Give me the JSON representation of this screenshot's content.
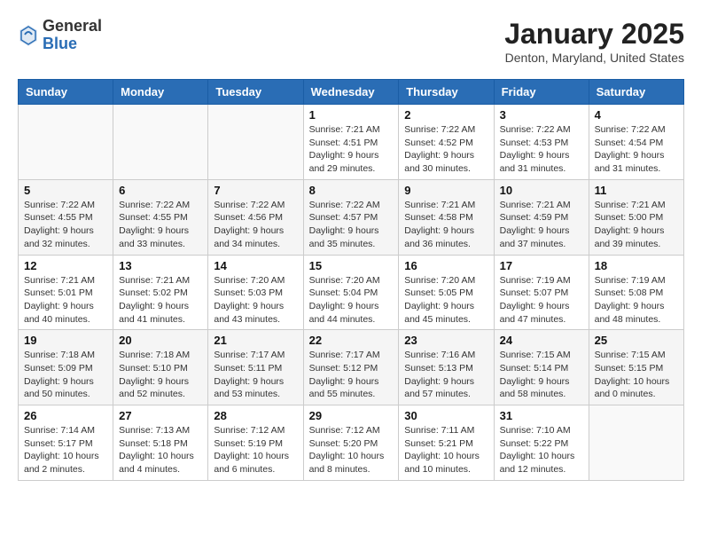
{
  "header": {
    "logo_general": "General",
    "logo_blue": "Blue",
    "month": "January 2025",
    "location": "Denton, Maryland, United States"
  },
  "weekdays": [
    "Sunday",
    "Monday",
    "Tuesday",
    "Wednesday",
    "Thursday",
    "Friday",
    "Saturday"
  ],
  "weeks": [
    [
      {
        "day": "",
        "sunrise": "",
        "sunset": "",
        "daylight": ""
      },
      {
        "day": "",
        "sunrise": "",
        "sunset": "",
        "daylight": ""
      },
      {
        "day": "",
        "sunrise": "",
        "sunset": "",
        "daylight": ""
      },
      {
        "day": "1",
        "sunrise": "Sunrise: 7:21 AM",
        "sunset": "Sunset: 4:51 PM",
        "daylight": "Daylight: 9 hours and 29 minutes."
      },
      {
        "day": "2",
        "sunrise": "Sunrise: 7:22 AM",
        "sunset": "Sunset: 4:52 PM",
        "daylight": "Daylight: 9 hours and 30 minutes."
      },
      {
        "day": "3",
        "sunrise": "Sunrise: 7:22 AM",
        "sunset": "Sunset: 4:53 PM",
        "daylight": "Daylight: 9 hours and 31 minutes."
      },
      {
        "day": "4",
        "sunrise": "Sunrise: 7:22 AM",
        "sunset": "Sunset: 4:54 PM",
        "daylight": "Daylight: 9 hours and 31 minutes."
      }
    ],
    [
      {
        "day": "5",
        "sunrise": "Sunrise: 7:22 AM",
        "sunset": "Sunset: 4:55 PM",
        "daylight": "Daylight: 9 hours and 32 minutes."
      },
      {
        "day": "6",
        "sunrise": "Sunrise: 7:22 AM",
        "sunset": "Sunset: 4:55 PM",
        "daylight": "Daylight: 9 hours and 33 minutes."
      },
      {
        "day": "7",
        "sunrise": "Sunrise: 7:22 AM",
        "sunset": "Sunset: 4:56 PM",
        "daylight": "Daylight: 9 hours and 34 minutes."
      },
      {
        "day": "8",
        "sunrise": "Sunrise: 7:22 AM",
        "sunset": "Sunset: 4:57 PM",
        "daylight": "Daylight: 9 hours and 35 minutes."
      },
      {
        "day": "9",
        "sunrise": "Sunrise: 7:21 AM",
        "sunset": "Sunset: 4:58 PM",
        "daylight": "Daylight: 9 hours and 36 minutes."
      },
      {
        "day": "10",
        "sunrise": "Sunrise: 7:21 AM",
        "sunset": "Sunset: 4:59 PM",
        "daylight": "Daylight: 9 hours and 37 minutes."
      },
      {
        "day": "11",
        "sunrise": "Sunrise: 7:21 AM",
        "sunset": "Sunset: 5:00 PM",
        "daylight": "Daylight: 9 hours and 39 minutes."
      }
    ],
    [
      {
        "day": "12",
        "sunrise": "Sunrise: 7:21 AM",
        "sunset": "Sunset: 5:01 PM",
        "daylight": "Daylight: 9 hours and 40 minutes."
      },
      {
        "day": "13",
        "sunrise": "Sunrise: 7:21 AM",
        "sunset": "Sunset: 5:02 PM",
        "daylight": "Daylight: 9 hours and 41 minutes."
      },
      {
        "day": "14",
        "sunrise": "Sunrise: 7:20 AM",
        "sunset": "Sunset: 5:03 PM",
        "daylight": "Daylight: 9 hours and 43 minutes."
      },
      {
        "day": "15",
        "sunrise": "Sunrise: 7:20 AM",
        "sunset": "Sunset: 5:04 PM",
        "daylight": "Daylight: 9 hours and 44 minutes."
      },
      {
        "day": "16",
        "sunrise": "Sunrise: 7:20 AM",
        "sunset": "Sunset: 5:05 PM",
        "daylight": "Daylight: 9 hours and 45 minutes."
      },
      {
        "day": "17",
        "sunrise": "Sunrise: 7:19 AM",
        "sunset": "Sunset: 5:07 PM",
        "daylight": "Daylight: 9 hours and 47 minutes."
      },
      {
        "day": "18",
        "sunrise": "Sunrise: 7:19 AM",
        "sunset": "Sunset: 5:08 PM",
        "daylight": "Daylight: 9 hours and 48 minutes."
      }
    ],
    [
      {
        "day": "19",
        "sunrise": "Sunrise: 7:18 AM",
        "sunset": "Sunset: 5:09 PM",
        "daylight": "Daylight: 9 hours and 50 minutes."
      },
      {
        "day": "20",
        "sunrise": "Sunrise: 7:18 AM",
        "sunset": "Sunset: 5:10 PM",
        "daylight": "Daylight: 9 hours and 52 minutes."
      },
      {
        "day": "21",
        "sunrise": "Sunrise: 7:17 AM",
        "sunset": "Sunset: 5:11 PM",
        "daylight": "Daylight: 9 hours and 53 minutes."
      },
      {
        "day": "22",
        "sunrise": "Sunrise: 7:17 AM",
        "sunset": "Sunset: 5:12 PM",
        "daylight": "Daylight: 9 hours and 55 minutes."
      },
      {
        "day": "23",
        "sunrise": "Sunrise: 7:16 AM",
        "sunset": "Sunset: 5:13 PM",
        "daylight": "Daylight: 9 hours and 57 minutes."
      },
      {
        "day": "24",
        "sunrise": "Sunrise: 7:15 AM",
        "sunset": "Sunset: 5:14 PM",
        "daylight": "Daylight: 9 hours and 58 minutes."
      },
      {
        "day": "25",
        "sunrise": "Sunrise: 7:15 AM",
        "sunset": "Sunset: 5:15 PM",
        "daylight": "Daylight: 10 hours and 0 minutes."
      }
    ],
    [
      {
        "day": "26",
        "sunrise": "Sunrise: 7:14 AM",
        "sunset": "Sunset: 5:17 PM",
        "daylight": "Daylight: 10 hours and 2 minutes."
      },
      {
        "day": "27",
        "sunrise": "Sunrise: 7:13 AM",
        "sunset": "Sunset: 5:18 PM",
        "daylight": "Daylight: 10 hours and 4 minutes."
      },
      {
        "day": "28",
        "sunrise": "Sunrise: 7:12 AM",
        "sunset": "Sunset: 5:19 PM",
        "daylight": "Daylight: 10 hours and 6 minutes."
      },
      {
        "day": "29",
        "sunrise": "Sunrise: 7:12 AM",
        "sunset": "Sunset: 5:20 PM",
        "daylight": "Daylight: 10 hours and 8 minutes."
      },
      {
        "day": "30",
        "sunrise": "Sunrise: 7:11 AM",
        "sunset": "Sunset: 5:21 PM",
        "daylight": "Daylight: 10 hours and 10 minutes."
      },
      {
        "day": "31",
        "sunrise": "Sunrise: 7:10 AM",
        "sunset": "Sunset: 5:22 PM",
        "daylight": "Daylight: 10 hours and 12 minutes."
      },
      {
        "day": "",
        "sunrise": "",
        "sunset": "",
        "daylight": ""
      }
    ]
  ]
}
